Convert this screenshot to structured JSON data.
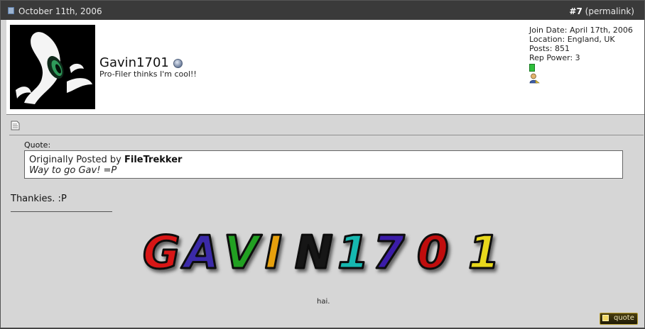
{
  "post": {
    "date": "October 11th, 2006",
    "number": "#7",
    "permalink": "(permalink)"
  },
  "user": {
    "name": "Gavin1701",
    "title": "Pro-Filer thinks I'm cool!!",
    "join_date": "Join Date: April 17th, 2006",
    "location": "Location: England, UK",
    "posts": "Posts: 851",
    "rep_power": "Rep Power: 3"
  },
  "quote": {
    "label": "Quote:",
    "originally_posted_by": "Originally Posted by",
    "author": "FileTrekker",
    "text": "Way to go Gav! =P"
  },
  "message": "Thankies. :P",
  "signature": {
    "banner_text": "GAVIN1701",
    "caption": "hai."
  },
  "buttons": {
    "quote": "quote"
  },
  "icons": {
    "post_doc": "document-icon",
    "online_status": "online-status-icon",
    "reputation": "reputation-icon",
    "user_profile": "user-profile-icon",
    "post_page": "page-icon"
  }
}
